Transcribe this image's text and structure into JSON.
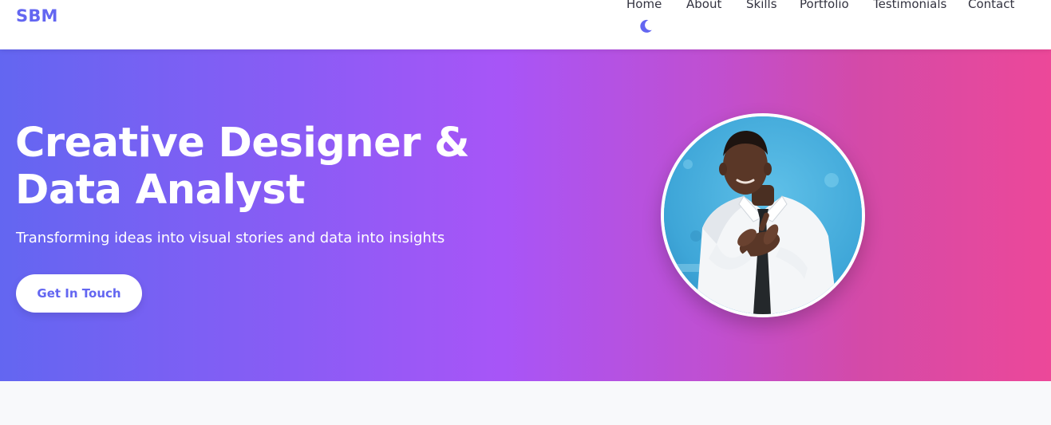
{
  "brand": {
    "name": "SBM",
    "color": "#6366f1"
  },
  "nav": {
    "links": [
      {
        "label": "Home"
      },
      {
        "label": "About"
      },
      {
        "label": "Skills"
      },
      {
        "label": "Portfolio"
      },
      {
        "label": "Testimonials"
      },
      {
        "label": "Contact"
      }
    ],
    "theme_toggle_icon": "moon-icon"
  },
  "hero": {
    "title_line1": "Creative Designer &",
    "title_line2": "Data Analyst",
    "subtitle": "Transforming ideas into visual stories and data into insights",
    "cta_label": "Get In Touch",
    "gradient_start": "#6366f1",
    "gradient_mid": "#a855f7",
    "gradient_end": "#ec4899",
    "avatar_icon": "profile-photo"
  }
}
